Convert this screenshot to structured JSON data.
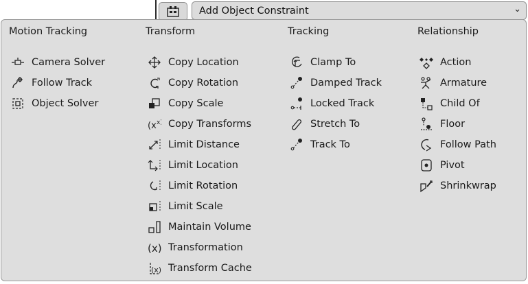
{
  "header": {
    "dropdown_label": "Add Object Constraint"
  },
  "menu": {
    "columns": [
      {
        "title": "Motion Tracking",
        "items": [
          {
            "label": "Camera Solver",
            "icon": "camera-solver-icon"
          },
          {
            "label": "Follow Track",
            "icon": "follow-track-icon"
          },
          {
            "label": "Object Solver",
            "icon": "object-solver-icon"
          }
        ]
      },
      {
        "title": "Transform",
        "items": [
          {
            "label": "Copy Location",
            "icon": "copy-location-icon"
          },
          {
            "label": "Copy Rotation",
            "icon": "copy-rotation-icon"
          },
          {
            "label": "Copy Scale",
            "icon": "copy-scale-icon"
          },
          {
            "label": "Copy Transforms",
            "icon": "copy-transforms-icon"
          },
          {
            "label": "Limit Distance",
            "icon": "limit-distance-icon"
          },
          {
            "label": "Limit Location",
            "icon": "limit-location-icon"
          },
          {
            "label": "Limit Rotation",
            "icon": "limit-rotation-icon"
          },
          {
            "label": "Limit Scale",
            "icon": "limit-scale-icon"
          },
          {
            "label": "Maintain Volume",
            "icon": "maintain-volume-icon"
          },
          {
            "label": "Transformation",
            "icon": "transformation-icon"
          },
          {
            "label": "Transform Cache",
            "icon": "transform-cache-icon"
          }
        ]
      },
      {
        "title": "Tracking",
        "items": [
          {
            "label": "Clamp To",
            "icon": "clamp-to-icon"
          },
          {
            "label": "Damped Track",
            "icon": "damped-track-icon"
          },
          {
            "label": "Locked Track",
            "icon": "locked-track-icon"
          },
          {
            "label": "Stretch To",
            "icon": "stretch-to-icon"
          },
          {
            "label": "Track To",
            "icon": "track-to-icon"
          }
        ]
      },
      {
        "title": "Relationship",
        "items": [
          {
            "label": "Action",
            "icon": "action-icon"
          },
          {
            "label": "Armature",
            "icon": "armature-icon"
          },
          {
            "label": "Child Of",
            "icon": "child-of-icon"
          },
          {
            "label": "Floor",
            "icon": "floor-icon"
          },
          {
            "label": "Follow Path",
            "icon": "follow-path-icon"
          },
          {
            "label": "Pivot",
            "icon": "pivot-icon"
          },
          {
            "label": "Shrinkwrap",
            "icon": "shrinkwrap-icon"
          }
        ]
      }
    ]
  }
}
